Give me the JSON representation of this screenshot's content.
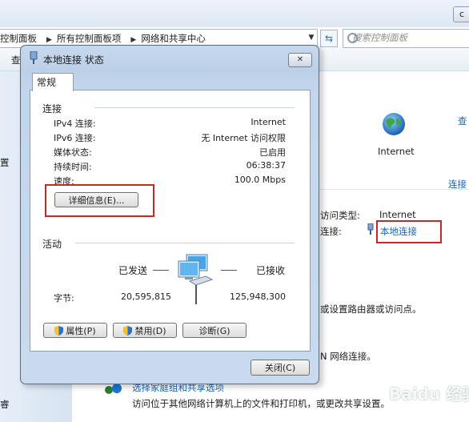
{
  "background_window": {
    "close_glyph": "c",
    "breadcrumb": [
      "控制面板",
      "所有控制面板项",
      "网络和共享中心"
    ],
    "search_placeholder": "搜索控制面板",
    "toolbar_fragment": "查",
    "sidebar_fragment_1": "置",
    "sidebar_fragment_2": "睿",
    "network_name": "Internet",
    "right_link_1": "查",
    "right_link_2": "连接",
    "access_type_label": "访问类型:",
    "access_type_value": "Internet",
    "connections_label": "连接:",
    "connections_link": "本地连接",
    "text_router": "或设置路由器或访问点。",
    "text_vpn": "N 网络连接。",
    "homegroup_title": "选择家庭组和共享选项",
    "homegroup_desc": "访问位于其他网络计算机上的文件和打印机，或更改共享设置。",
    "watermark": "Baidu 经验"
  },
  "dialog": {
    "title": "本地连接 状态",
    "close_glyph": "✕",
    "tab": "常规",
    "connection_section": "连接",
    "rows": [
      {
        "label": "IPv4 连接:",
        "value": "Internet"
      },
      {
        "label": "IPv6 连接:",
        "value": "无 Internet 访问权限"
      },
      {
        "label": "媒体状态:",
        "value": "已启用"
      },
      {
        "label": "持续时间:",
        "value": "06:38:37"
      },
      {
        "label": "速度:",
        "value": "100.0 Mbps"
      }
    ],
    "details_button": "详细信息(E)...",
    "activity_section": "活动",
    "sent_label": "已发送",
    "received_label": "已接收",
    "bytes_label": "字节:",
    "bytes_sent": "20,595,815",
    "bytes_received": "125,948,300",
    "properties_button": "属性(P)",
    "disable_button": "禁用(D)",
    "diagnose_button": "诊断(G)",
    "close_button": "关闭(C)"
  }
}
